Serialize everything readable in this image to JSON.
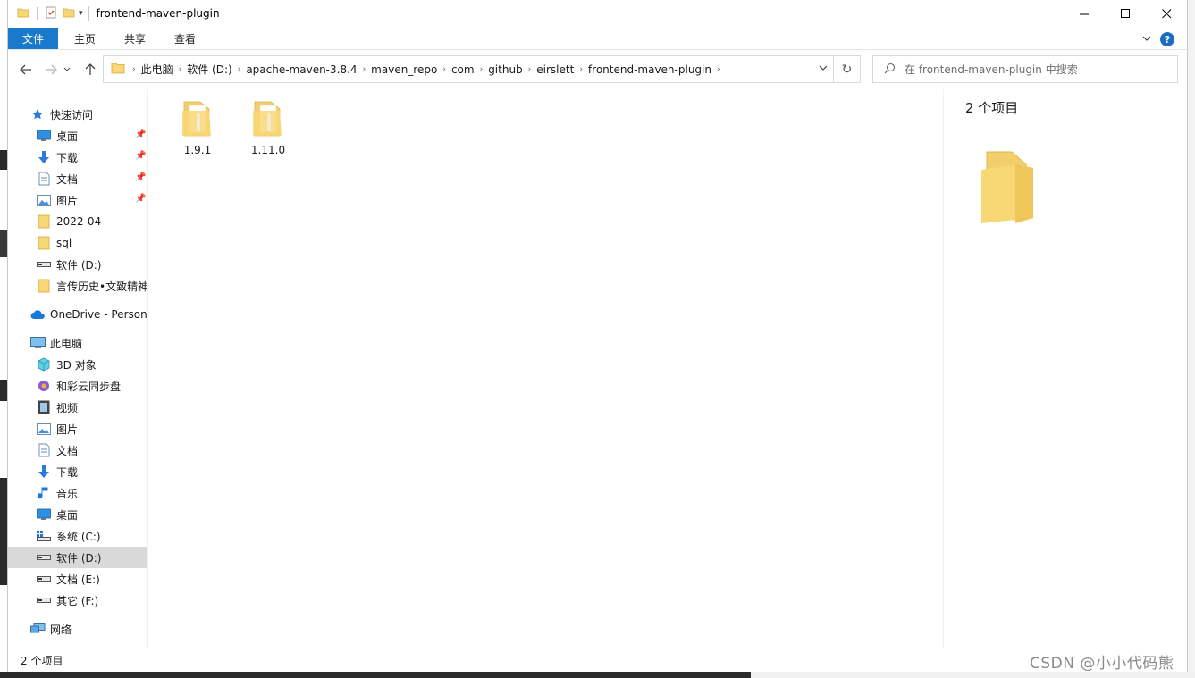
{
  "window": {
    "title": "frontend-maven-plugin",
    "controls": {
      "minimize": "—",
      "maximize": "☐",
      "close": "✕"
    }
  },
  "ribbon": {
    "tabs": [
      {
        "label": "文件",
        "active": true
      },
      {
        "label": "主页",
        "active": false
      },
      {
        "label": "共享",
        "active": false
      },
      {
        "label": "查看",
        "active": false
      }
    ],
    "help": "?"
  },
  "address": {
    "crumbs": [
      "此电脑",
      "软件 (D:)",
      "apache-maven-3.8.4",
      "maven_repo",
      "com",
      "github",
      "eirslett",
      "frontend-maven-plugin"
    ]
  },
  "search": {
    "placeholder": "在 frontend-maven-plugin 中搜索"
  },
  "nav": {
    "quick_access": "快速访问",
    "quick_items": [
      {
        "label": "桌面",
        "icon": "desktop-icon",
        "pinned": true
      },
      {
        "label": "下载",
        "icon": "download-icon",
        "pinned": true
      },
      {
        "label": "文档",
        "icon": "document-icon",
        "pinned": true
      },
      {
        "label": "图片",
        "icon": "picture-icon",
        "pinned": true
      },
      {
        "label": "2022-04",
        "icon": "folder-icon",
        "pinned": false
      },
      {
        "label": "sql",
        "icon": "folder-icon",
        "pinned": false
      },
      {
        "label": "软件 (D:)",
        "icon": "drive-icon",
        "pinned": false
      },
      {
        "label": "言传历史•文致精神'",
        "icon": "folder-icon",
        "pinned": false
      }
    ],
    "onedrive": "OneDrive - Persona",
    "this_pc": "此电脑",
    "pc_items": [
      {
        "label": "3D 对象",
        "icon": "3d-objects-icon",
        "selected": false
      },
      {
        "label": "和彩云同步盘",
        "icon": "cloud-sync-icon",
        "selected": false
      },
      {
        "label": "视频",
        "icon": "video-icon",
        "selected": false
      },
      {
        "label": "图片",
        "icon": "picture-icon",
        "selected": false
      },
      {
        "label": "文档",
        "icon": "document-icon",
        "selected": false
      },
      {
        "label": "下载",
        "icon": "download-icon",
        "selected": false
      },
      {
        "label": "音乐",
        "icon": "music-icon",
        "selected": false
      },
      {
        "label": "桌面",
        "icon": "desktop-icon",
        "selected": false
      },
      {
        "label": "系统 (C:)",
        "icon": "system-drive-icon",
        "selected": false
      },
      {
        "label": "软件 (D:)",
        "icon": "drive-icon",
        "selected": true
      },
      {
        "label": "文档 (E:)",
        "icon": "drive-icon",
        "selected": false
      },
      {
        "label": "其它 (F:)",
        "icon": "drive-icon",
        "selected": false
      }
    ],
    "network": "网络"
  },
  "files": [
    {
      "name": "1.9.1"
    },
    {
      "name": "1.11.0"
    }
  ],
  "preview": {
    "count": "2 个项目"
  },
  "status": {
    "text": "2 个项目"
  },
  "watermark": "CSDN @小小代码熊",
  "colors": {
    "accent": "#1979ca",
    "folder": "#f8d775",
    "selected_row": "#d9d9d9"
  }
}
